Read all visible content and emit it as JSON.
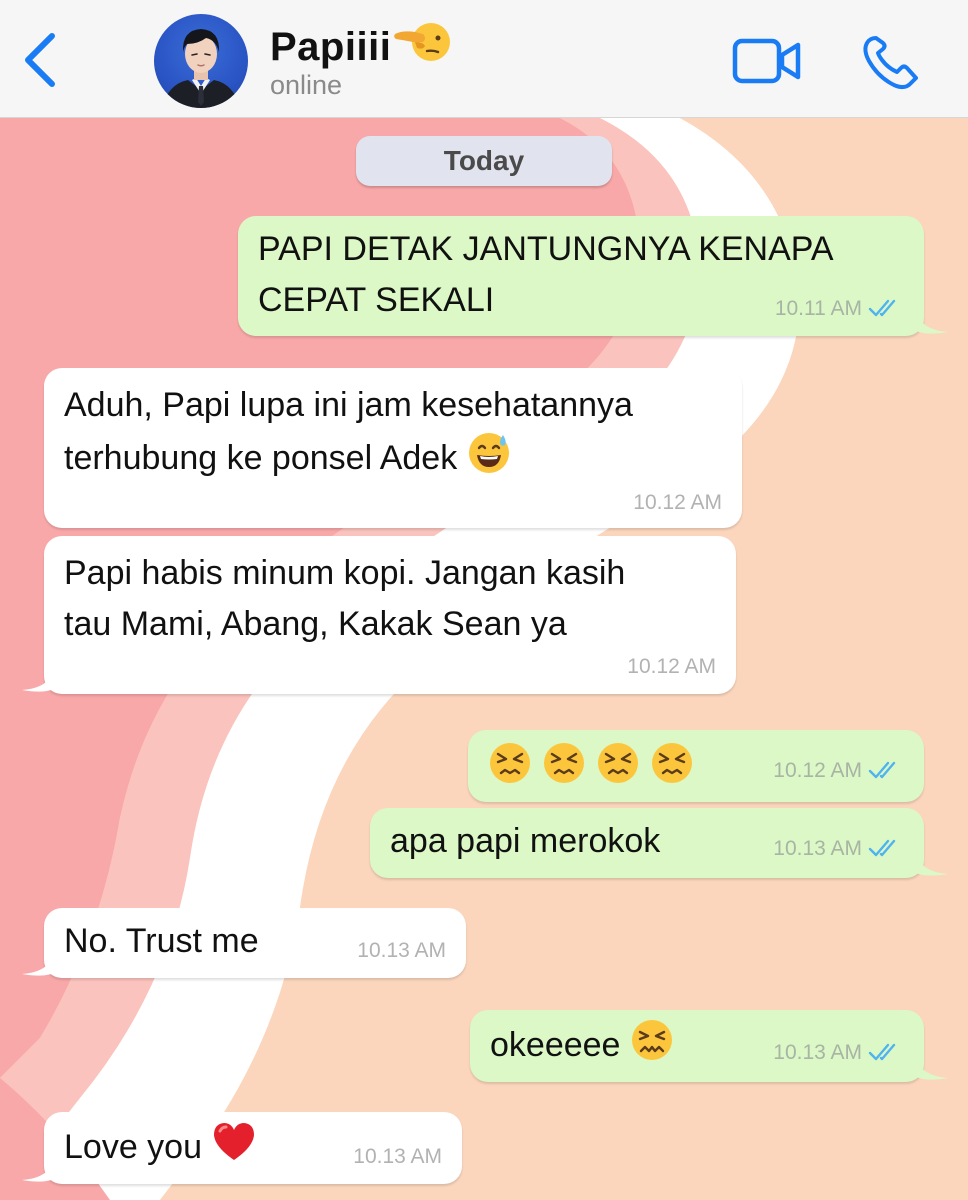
{
  "header": {
    "contact_name": "Papiiii",
    "name_emoji": "pointing-hand-emoji",
    "status": "online",
    "back_icon": "chevron-left-icon",
    "video_icon": "video-camera-icon",
    "call_icon": "phone-icon",
    "accent_color": "#1a7cf5"
  },
  "date_separator": "Today",
  "messages": [
    {
      "direction": "out",
      "lines": [
        "PAPI DETAK JANTUNGNYA KENAPA",
        "CEPAT SEKALI"
      ],
      "time": "10.11 AM",
      "status": "read"
    },
    {
      "direction": "in",
      "lines": [
        "Aduh, Papi lupa ini jam kesehatannya",
        "terhubung ke ponsel Adek"
      ],
      "emoji": "sweat-smile-emoji",
      "time": "10.12 AM"
    },
    {
      "direction": "in",
      "lines": [
        "Papi habis minum kopi. Jangan kasih",
        "tau Mami, Abang, Kakak Sean ya"
      ],
      "time": "10.12 AM"
    },
    {
      "direction": "out",
      "lines": [
        ""
      ],
      "emoji": "persevering-face-emoji x4",
      "time": "10.12 AM",
      "status": "read"
    },
    {
      "direction": "out",
      "lines": [
        "apa papi merokok"
      ],
      "time": "10.13 AM",
      "status": "read"
    },
    {
      "direction": "in",
      "lines": [
        "No. Trust me"
      ],
      "time": "10.13 AM"
    },
    {
      "direction": "out",
      "lines": [
        "okeeeee"
      ],
      "emoji": "confounded-face-emoji",
      "time": "10.13 AM",
      "status": "read"
    },
    {
      "direction": "in",
      "lines": [
        "Love you"
      ],
      "emoji": "red-heart-emoji",
      "time": "10.13 AM"
    }
  ],
  "colors": {
    "outgoing_bubble": "#dcf8c6",
    "incoming_bubble": "#ffffff",
    "read_ticks": "#4fb3f0",
    "wallpaper_pink": "#f7a9ab",
    "wallpaper_peach": "#fbd6bd"
  }
}
